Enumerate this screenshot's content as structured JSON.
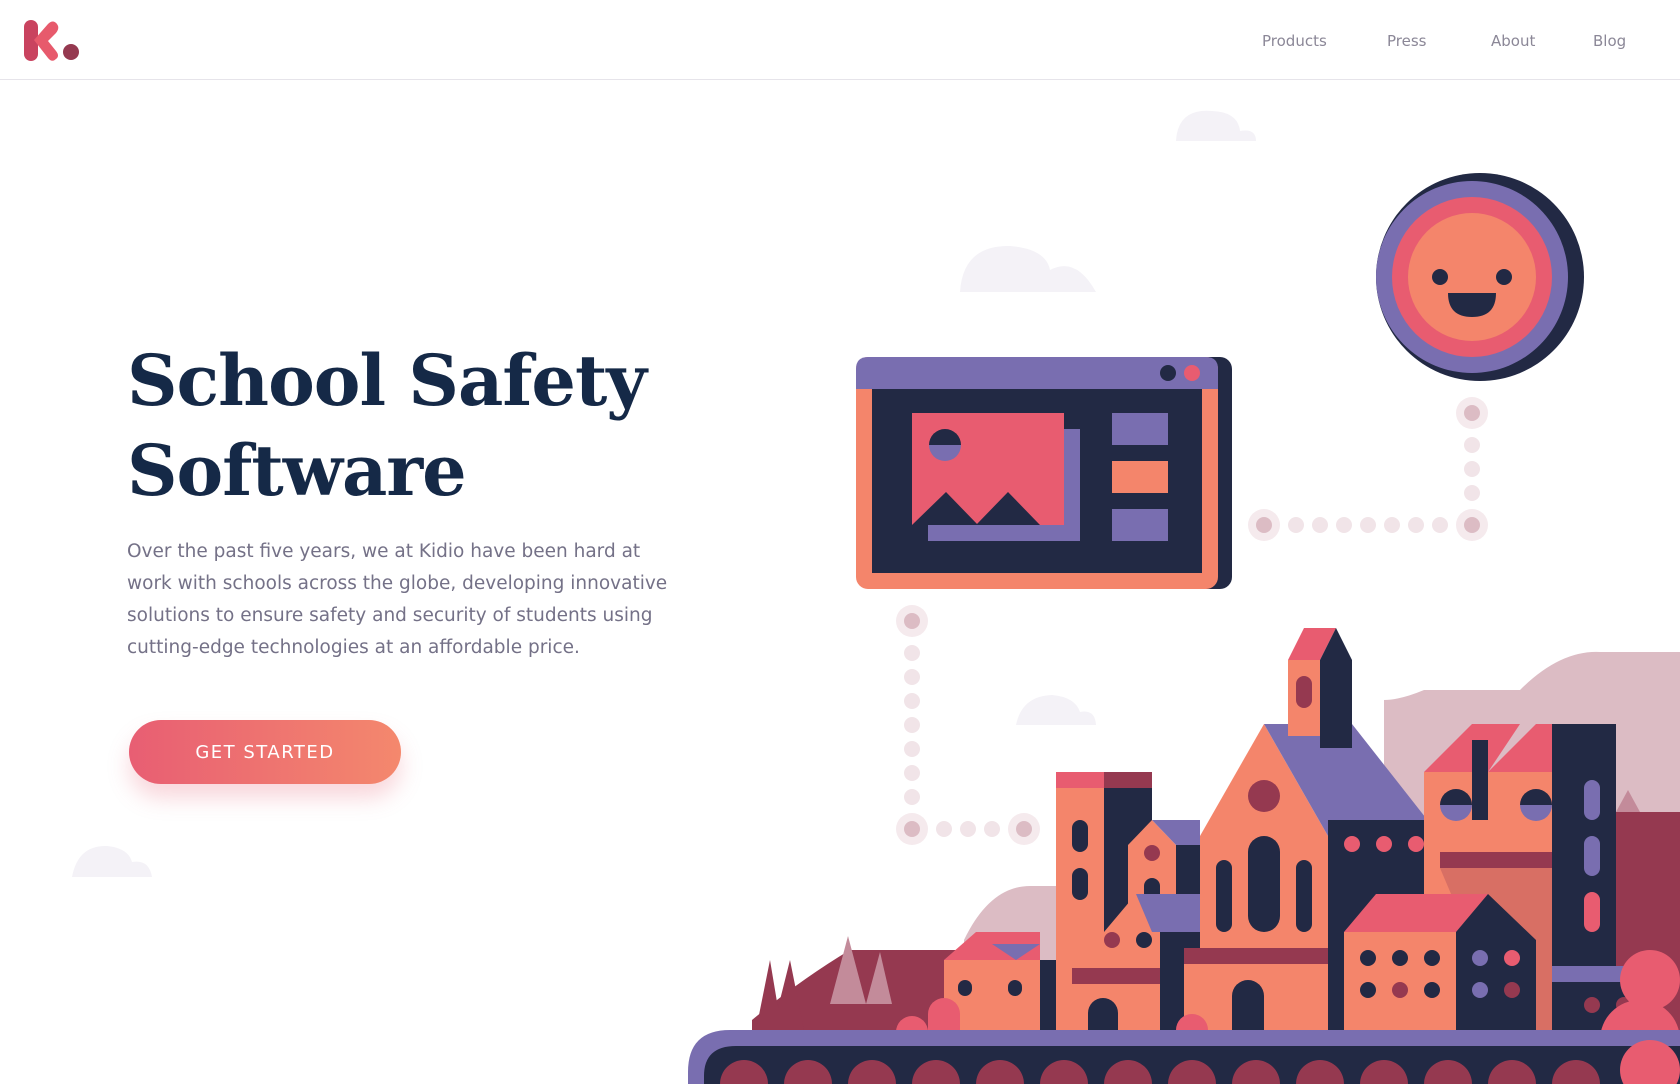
{
  "header": {
    "logo_icon": "kidio-logo-icon",
    "nav": [
      {
        "label": "Products"
      },
      {
        "label": "Press"
      },
      {
        "label": "About"
      },
      {
        "label": "Blog"
      }
    ]
  },
  "hero": {
    "title_line1": "School Safety",
    "title_line2": "Software",
    "description": "Over the past five years, we at Kidio have been hard at work with schools across the globe, developing innovative solutions to ensure safety and security of students using cutting-edge technologies at an affordable price.",
    "cta_label": "GET STARTED"
  },
  "illustration": {
    "icons": [
      "browser-window-icon",
      "smiley-face-icon",
      "town-buildings-icon",
      "cloud-icon"
    ],
    "colors": {
      "navy": "#222944",
      "purple": "#796eb0",
      "coral": "#f4856b",
      "pink": "#e85c70",
      "maroon": "#953950",
      "dusty_pink": "#dcbcc4",
      "dot": "#f1e4e8"
    }
  },
  "colors": {
    "title": "#152947",
    "body_text": "#747187",
    "nav_text": "#8b8797",
    "cta_gradient_start": "#e85e73",
    "cta_gradient_end": "#f4886d"
  }
}
